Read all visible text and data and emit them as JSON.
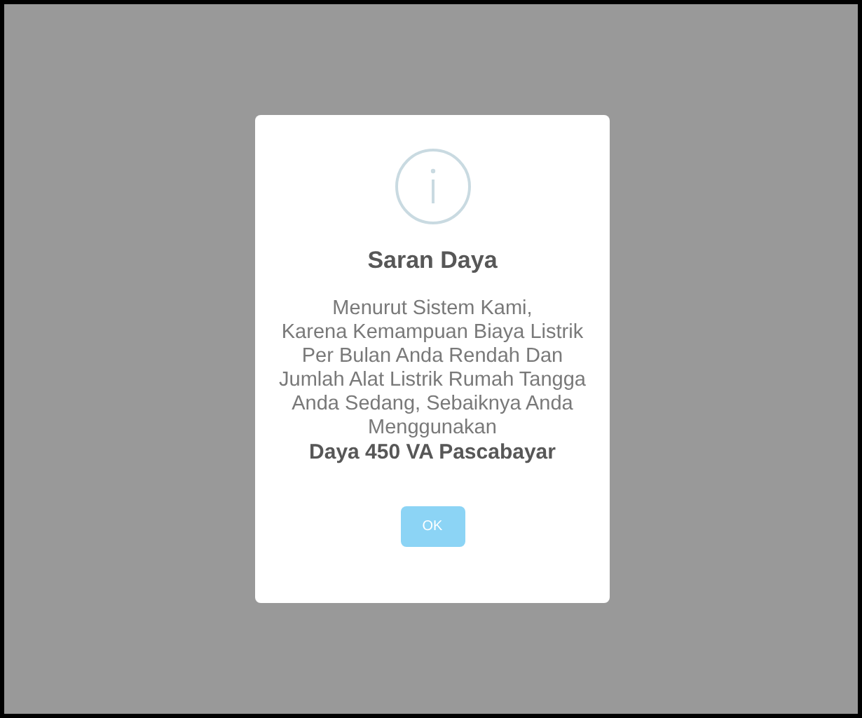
{
  "dialog": {
    "title": "Saran Daya",
    "message": "Menurut Sistem Kami,\nKarena Kemampuan Biaya Listrik\nPer Bulan Anda Rendah Dan\nJumlah Alat Listrik Rumah Tangga\nAnda Sedang, Sebaiknya Anda\nMenggunakan\n**Daya 450 VA Pascabayar**",
    "button": "OK"
  }
}
